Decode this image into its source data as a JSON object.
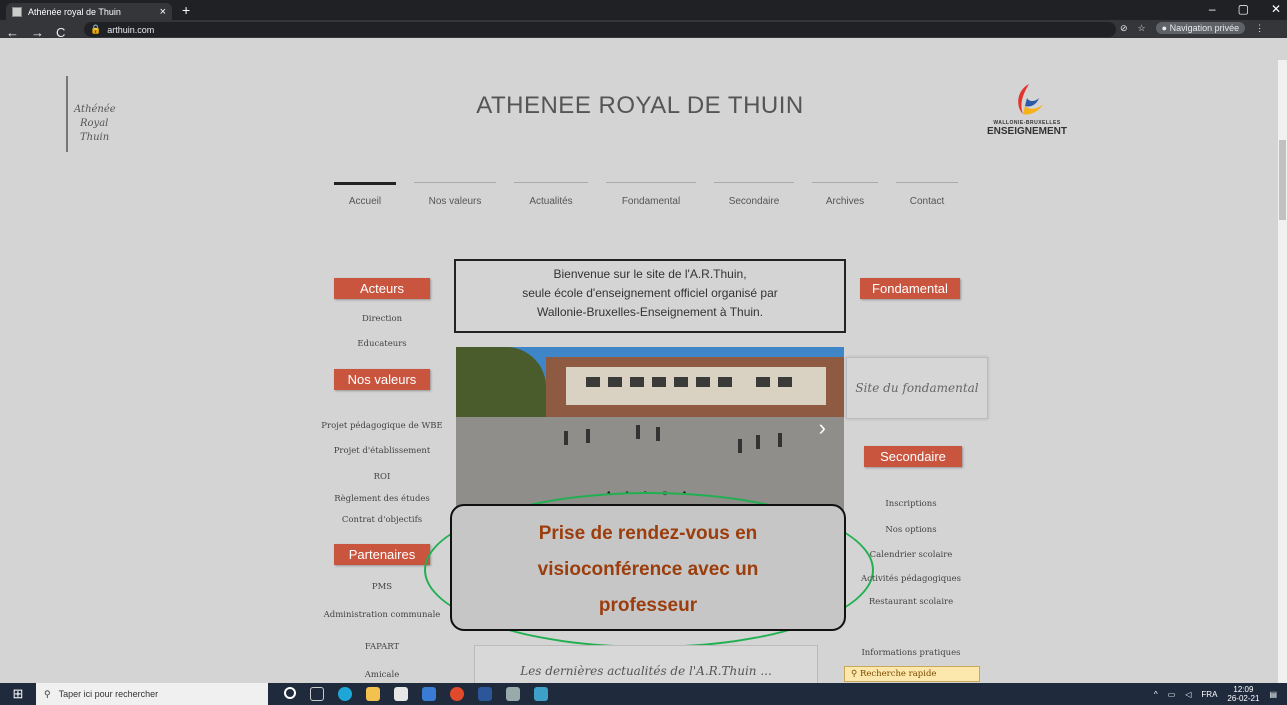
{
  "browser": {
    "tab_title": "Athénée royal de Thuin",
    "tab_close": "×",
    "new_tab": "+",
    "url": "arthuin.com",
    "back": "←",
    "forward": "→",
    "reload": "C",
    "private_label": "Navigation privée",
    "win_min": "–",
    "win_max": "▢",
    "win_close": "✕"
  },
  "header": {
    "logo_lines": [
      "Athénée",
      "Royal",
      "Thuin"
    ],
    "title": "ATHENEE ROYAL DE THUIN",
    "wbe_line1": "WALLONIE-BRUXELLES",
    "wbe_line2": "ENSEIGNEMENT"
  },
  "menu": [
    "Accueil",
    "Nos valeurs",
    "Actualités",
    "Fondamental",
    "Secondaire",
    "Archives",
    "Contact"
  ],
  "left": {
    "acteurs": "Acteurs",
    "acteurs_links": [
      "Direction",
      "Educateurs"
    ],
    "valeurs": "Nos valeurs",
    "valeurs_links": [
      "Projet pédagogique de WBE",
      "Projet d'établissement",
      "ROI",
      "Règlement des études",
      "Contrat d'objectifs"
    ],
    "partenaires": "Partenaires",
    "partenaires_links": [
      "PMS",
      "Administration communale",
      "FAPART",
      "Amicale"
    ]
  },
  "welcome": {
    "line1": "Bienvenue sur le site de l'A.R.Thuin,",
    "line2": "seule école d'enseignement officiel organisé par",
    "line3": "Wallonie-Bruxelles-Enseignement à Thuin."
  },
  "slider": {
    "dots": "• • • ○ •",
    "next": "›"
  },
  "cta": {
    "line1": "Prise de rendez-vous en",
    "line2": "visioconférence avec un",
    "line3": "professeur"
  },
  "right": {
    "fondamental": "Fondamental",
    "fond_card": "Site du fondamental",
    "secondaire": "Secondaire",
    "sec_links": [
      "Inscriptions",
      "Nos options",
      "Calendrier scolaire",
      "Activités pédagogiques",
      "Restaurant scolaire",
      "Informations pratiques"
    ],
    "search": "Recherche rapide"
  },
  "news": "Les dernières actualités de l'A.R.Thuin ...",
  "taskbar": {
    "search_placeholder": "Taper ici pour rechercher",
    "lang": "FRA",
    "time": "12:09",
    "date": "26-02-21"
  },
  "colors": {
    "accent": "#c9553f",
    "cta_text": "#9b3d0c",
    "oval": "#20b050"
  }
}
